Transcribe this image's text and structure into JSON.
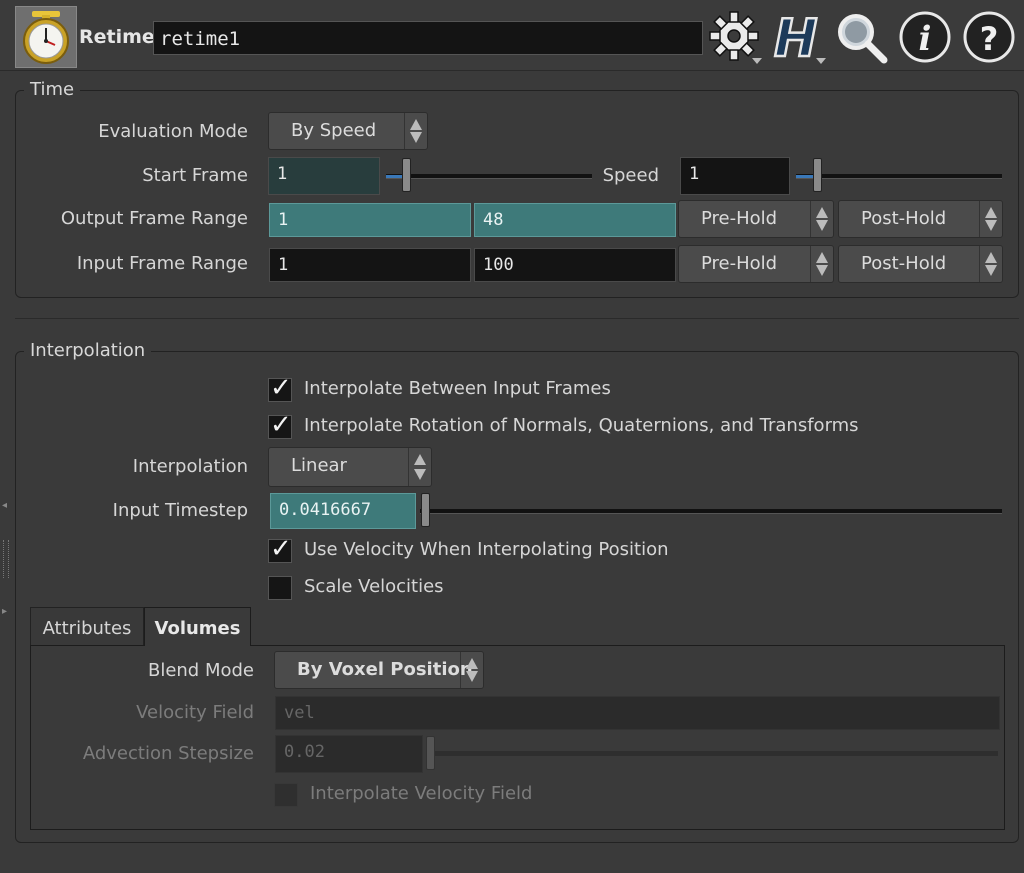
{
  "header": {
    "node_type": "Retime",
    "node_name": "retime1",
    "icons": [
      "stopwatch-icon",
      "gear-icon",
      "houdini-help-icon",
      "search-icon",
      "info-icon",
      "help-icon"
    ]
  },
  "time": {
    "title": "Time",
    "evaluation_mode_label": "Evaluation Mode",
    "evaluation_mode_value": "By Speed",
    "start_frame_label": "Start Frame",
    "start_frame_value": "1",
    "speed_label": "Speed",
    "speed_value": "1",
    "output_frame_range_label": "Output Frame Range",
    "output_frame_start": "1",
    "output_frame_end": "48",
    "output_pre_hold": "Pre-Hold",
    "output_post_hold": "Post-Hold",
    "input_frame_range_label": "Input Frame Range",
    "input_frame_start": "1",
    "input_frame_end": "100",
    "input_pre_hold": "Pre-Hold",
    "input_post_hold": "Post-Hold"
  },
  "interpolation": {
    "title": "Interpolation",
    "interp_between_label": "Interpolate Between Input Frames",
    "interp_between_checked": true,
    "interp_rotation_label": "Interpolate Rotation of Normals, Quaternions, and Transforms",
    "interp_rotation_checked": true,
    "interpolation_label": "Interpolation",
    "interpolation_value": "Linear",
    "input_timestep_label": "Input Timestep",
    "input_timestep_value": "0.0416667",
    "use_velocity_label": "Use Velocity When Interpolating Position",
    "use_velocity_checked": true,
    "scale_velocities_label": "Scale Velocities",
    "scale_velocities_checked": false
  },
  "tabs": [
    {
      "label": "Attributes",
      "active": false
    },
    {
      "label": "Volumes",
      "active": true
    }
  ],
  "volumes": {
    "blend_mode_label": "Blend Mode",
    "blend_mode_value": "By Voxel Position",
    "velocity_field_label": "Velocity Field",
    "velocity_field_value": "vel",
    "advection_stepsize_label": "Advection Stepsize",
    "advection_stepsize_value": "0.02",
    "interp_velocity_field_label": "Interpolate Velocity Field",
    "interp_velocity_field_checked": false
  },
  "colors": {
    "background": "#3a3a3a",
    "field": "#141414",
    "teal_field": "#3e7a7a",
    "slider_fill": "#3a78b8"
  }
}
